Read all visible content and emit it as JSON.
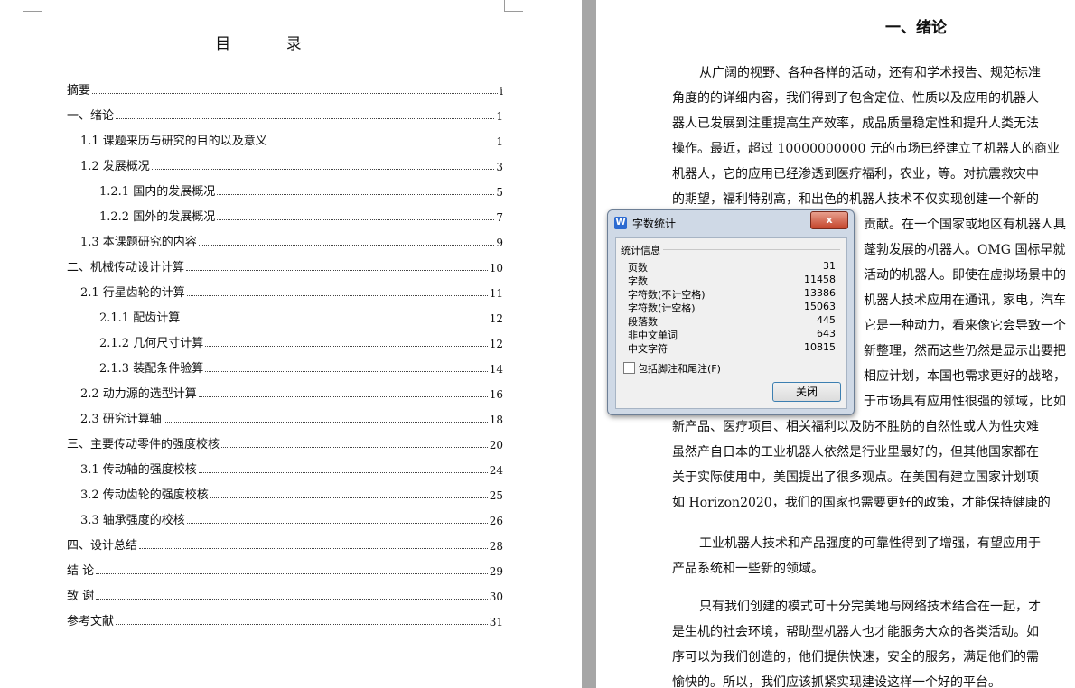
{
  "toc": {
    "title": "目  录",
    "entries": [
      {
        "label": "摘要",
        "page": "i"
      },
      {
        "label": "一、绪论",
        "page": "1"
      },
      {
        "label": "1.1 课题来历与研究的目的以及意义",
        "page": "1"
      },
      {
        "label": "1.2 发展概况",
        "page": "3"
      },
      {
        "label": "1.2.1 国内的发展概况",
        "page": "5"
      },
      {
        "label": "1.2.2 国外的发展概况",
        "page": "7"
      },
      {
        "label": "1.3 本课题研究的内容",
        "page": "9"
      },
      {
        "label": "二、机械传动设计计算",
        "page": "10"
      },
      {
        "label": "2.1 行星齿轮的计算",
        "page": "11"
      },
      {
        "label": "2.1.1 配齿计算",
        "page": "12"
      },
      {
        "label": "2.1.2 几何尺寸计算",
        "page": "12"
      },
      {
        "label": "2.1.3 装配条件验算",
        "page": "14"
      },
      {
        "label": "2.2 动力源的选型计算",
        "page": "16"
      },
      {
        "label": "2.3 研究计算轴",
        "page": "18"
      },
      {
        "label": "三、主要传动零件的强度校核",
        "page": "20"
      },
      {
        "label": "3.1 传动轴的强度校核",
        "page": "24"
      },
      {
        "label": "3.2 传动齿轮的强度校核",
        "page": "25"
      },
      {
        "label": "3.3 轴承强度的校核",
        "page": "26"
      },
      {
        "label": "四、设计总结",
        "page": "28"
      },
      {
        "label": "结    论",
        "page": "29"
      },
      {
        "label": "致    谢",
        "page": "30"
      },
      {
        "label": "参考文献",
        "page": "31"
      }
    ]
  },
  "chapter": {
    "title": "一、绪论",
    "lines": [
      "从广阔的视野、各种各样的活动，还有和学术报告、规范标准",
      "角度的的详细内容，我们得到了包含定位、性质以及应用的机器人",
      "器人已发展到注重提高生产效率，成品质量稳定性和提升人类无法",
      "操作。最近，超过 10000000000 元的市场已经建立了机器人的商业",
      "机器人，它的应用已经渗透到医疗福利，农业，等。对抗震救灾中",
      "的期望，福利特别高，和出色的机器人技术不仅实现创建一个新的",
      "贡献。在一个国家或地区有机器人具",
      "蓬勃发展的机器人。OMG 国标早就",
      "活动的机器人。即使在虚拟场景中的",
      "机器人技术应用在通讯，家电，汽车",
      "它是一种动力，看来像它会导致一个",
      "新整理，然而这些仍然是显示出要把",
      "相应计划，本国也需求更好的战略，",
      "于市场具有应用性很强的领域，比如",
      "新产品、医疗项目、相关福利以及防不胜防的自然性或人为性灾难",
      "虽然产自日本的工业机器人依然是行业里最好的，但其他国家都在",
      "关于实际使用中，美国提出了很多观点。在美国有建立国家计划项",
      "如 Horizon2020，我们的国家也需要更好的政策，才能保持健康的",
      "工业机器人技术和产品强度的可靠性得到了增强，有望应用于",
      "产品系统和一些新的领域。",
      "只有我们创建的模式可十分完美地与网络技术结合在一起，才",
      "是生机的社会环境，帮助型机器人也才能服务大众的各类活动。如",
      "序可以为我们创造的，他们提供快速，安全的服务，满足他们的需",
      "愉快的。所以，我们应该抓紧实现建设这样一个好的平台。"
    ]
  },
  "dialog": {
    "title": "字数统计",
    "app_icon": "W",
    "close_x": "x",
    "group_label": "统计信息",
    "stats": [
      {
        "label": "页数",
        "value": "31"
      },
      {
        "label": "字数",
        "value": "11458"
      },
      {
        "label": "字符数(不计空格)",
        "value": "13386"
      },
      {
        "label": "字符数(计空格)",
        "value": "15063"
      },
      {
        "label": "段落数",
        "value": "445"
      },
      {
        "label": "非中文单词",
        "value": "643"
      },
      {
        "label": "中文字符",
        "value": "10815"
      }
    ],
    "footnote_label": "包括脚注和尾注(F)",
    "footnote_checked": false,
    "close_button": "关闭"
  }
}
